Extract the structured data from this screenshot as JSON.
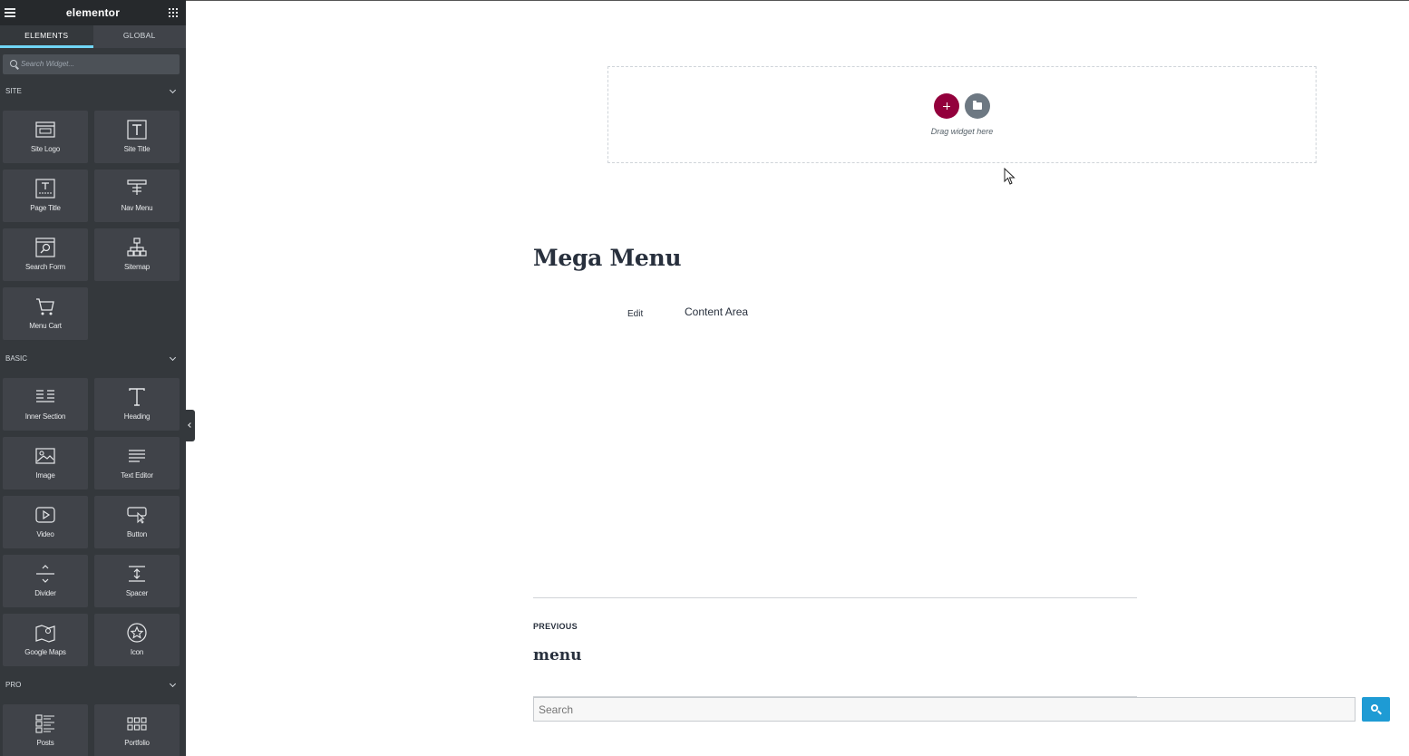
{
  "sidebar": {
    "logo": "elementor",
    "tabs": [
      "ELEMENTS",
      "GLOBAL"
    ],
    "search_placeholder": "Search Widget...",
    "sections": [
      {
        "label": "SITE",
        "widgets": [
          "Site Logo",
          "Site Title",
          "Page Title",
          "Nav Menu",
          "Search Form",
          "Sitemap",
          "Menu Cart"
        ]
      },
      {
        "label": "BASIC",
        "widgets": [
          "Inner Section",
          "Heading",
          "Image",
          "Text Editor",
          "Video",
          "Button",
          "Divider",
          "Spacer",
          "Google Maps",
          "Icon"
        ]
      },
      {
        "label": "PRO",
        "widgets": [
          "Posts",
          "Portfolio"
        ]
      }
    ]
  },
  "canvas": {
    "drop_hint": "Drag widget here",
    "post_title": "Mega Menu",
    "edit_link": "Edit",
    "content_area": "Content Area",
    "prev_label": "PREVIOUS",
    "prev_title": "menu",
    "search_placeholder": "Search"
  },
  "colors": {
    "accent": "#93003c",
    "sidebar_bg": "#34383c",
    "tab_underline": "#71d7f7",
    "search_button": "#1e9bd4"
  }
}
